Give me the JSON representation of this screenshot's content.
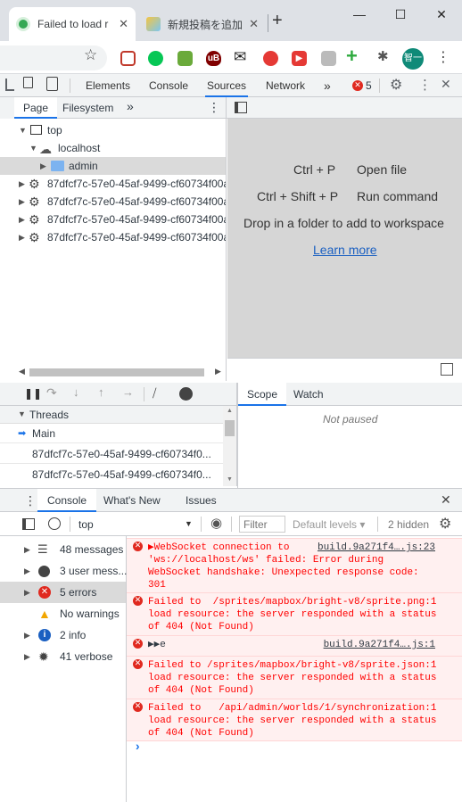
{
  "browser": {
    "tabs": [
      {
        "title": "Failed to load r",
        "close": "✕"
      },
      {
        "title": "新規投稿を追加",
        "close": "✕"
      }
    ],
    "new_tab": "+",
    "window_controls": {
      "minimize": "—",
      "maximize": "☐",
      "close": "✕"
    },
    "profile_label": "智一",
    "bookmark_star": "☆",
    "menu": "⋮"
  },
  "devtools": {
    "tabs": [
      "Elements",
      "Console",
      "Sources",
      "Network"
    ],
    "active_tab": "Sources",
    "more_tabs": "»",
    "error_count": "5",
    "navigator": {
      "tabs": [
        "Page",
        "Filesystem"
      ],
      "tree": [
        {
          "label": "top"
        },
        {
          "label": "localhost"
        },
        {
          "label": "admin"
        },
        {
          "label": "87dfcf7c-57e0-45af-9499-cf60734f00a"
        },
        {
          "label": "87dfcf7c-57e0-45af-9499-cf60734f00a"
        },
        {
          "label": "87dfcf7c-57e0-45af-9499-cf60734f00a"
        },
        {
          "label": "87dfcf7c-57e0-45af-9499-cf60734f00a"
        }
      ]
    },
    "editor": {
      "shortcut1_keys": "Ctrl + P",
      "shortcut1_action": "Open file",
      "shortcut2_keys": "Ctrl + Shift + P",
      "shortcut2_action": "Run command",
      "drop_hint": "Drop in a folder to add to workspace",
      "learn_more": "Learn more"
    },
    "debugger": {
      "threads_title": "Threads",
      "threads": [
        "Main",
        "87dfcf7c-57e0-45af-9499-cf60734f0...",
        "87dfcf7c-57e0-45af-9499-cf60734f0..."
      ],
      "scope_tabs": [
        "Scope",
        "Watch"
      ],
      "not_paused": "Not paused"
    },
    "drawer": {
      "tabs": [
        "Console",
        "What's New",
        "Issues"
      ],
      "close": "✕",
      "context": "top",
      "filter_placeholder": "Filter",
      "levels": "Default levels ▾",
      "hidden": "2 hidden"
    },
    "console_sidebar": [
      {
        "label": "48 messages"
      },
      {
        "label": "3 user mess..."
      },
      {
        "label": "5 errors"
      },
      {
        "label": "No warnings"
      },
      {
        "label": "2 info"
      },
      {
        "label": "41 verbose"
      }
    ],
    "messages": [
      {
        "text": "▶WebSocket connection to\n'ws://localhost/ws' failed: Error during\nWebSocket handshake: Unexpected response code:\n301",
        "source": "build.9a271f4….js:23"
      },
      {
        "text": "Failed to  /sprites/mapbox/bright-v8/sprite.png:1\nload resource: the server responded with a status\nof 404 (Not Found)",
        "source": ""
      },
      {
        "text": "▶▶e",
        "source": "build.9a271f4….js:1"
      },
      {
        "text": "Failed to /sprites/mapbox/bright-v8/sprite.json:1\nload resource: the server responded with a status\nof 404 (Not Found)",
        "source": ""
      },
      {
        "text": "Failed to   /api/admin/worlds/1/synchronization:1\nload resource: the server responded with a status\nof 404 (Not Found)",
        "source": ""
      }
    ],
    "prompt": "›"
  }
}
